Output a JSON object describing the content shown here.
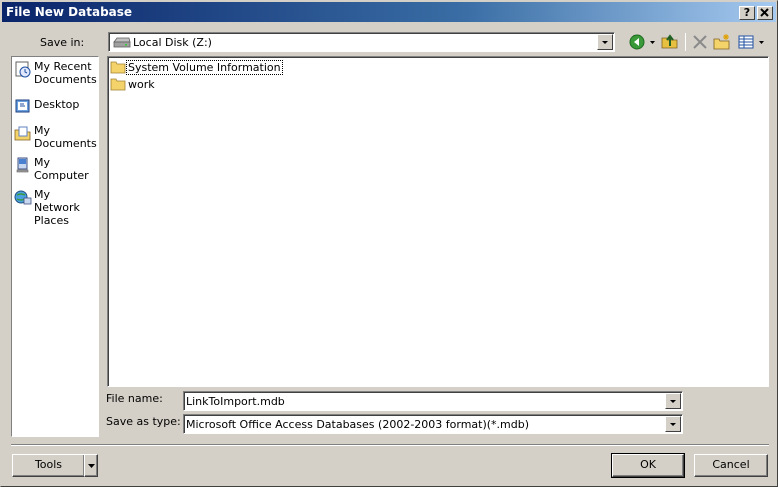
{
  "window": {
    "title": "File New Database",
    "help_button": "?",
    "close_button": "X"
  },
  "save_in": {
    "label": "Save in:",
    "value": "Local Disk (Z:)"
  },
  "places_bar": [
    {
      "label": "My Recent Documents",
      "icon": "recent-documents-icon"
    },
    {
      "label": "Desktop",
      "icon": "desktop-icon"
    },
    {
      "label": "My Documents",
      "icon": "my-documents-icon"
    },
    {
      "label": "My Computer",
      "icon": "my-computer-icon"
    },
    {
      "label": "My Network Places",
      "icon": "network-places-icon"
    }
  ],
  "files": [
    {
      "name": "System Volume Information",
      "icon": "folder-icon"
    },
    {
      "name": "work",
      "icon": "folder-icon"
    }
  ],
  "file_name": {
    "label": "File name:",
    "value": "LinkToImport.mdb"
  },
  "save_as_type": {
    "label": "Save as type:",
    "value": "Microsoft Office Access Databases (2002-2003 format)(*.mdb)"
  },
  "buttons": {
    "tools": "Tools",
    "ok": "OK",
    "cancel": "Cancel"
  },
  "colors": {
    "titlebar_start": "#0a246a",
    "titlebar_end": "#a6caf0",
    "face": "#d4d0c8",
    "folder": "#f4d46a"
  }
}
